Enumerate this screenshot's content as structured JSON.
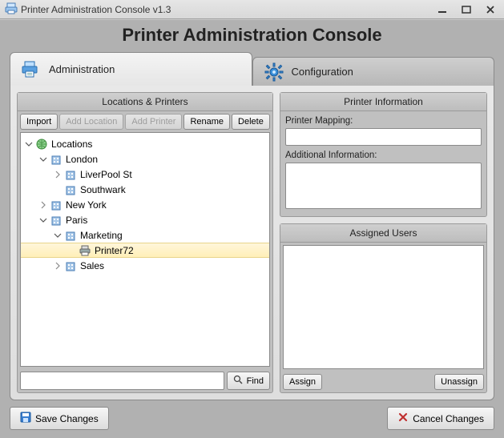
{
  "window": {
    "title": "Printer Administration Console v1.3",
    "page_heading": "Printer Administration Console"
  },
  "tabs": {
    "admin_label": "Administration",
    "config_label": "Configuration"
  },
  "left_panel": {
    "title": "Locations & Printers",
    "toolbar": {
      "import": "Import",
      "add_location": "Add Location",
      "add_printer": "Add Printer",
      "rename": "Rename",
      "delete": "Delete"
    },
    "find_label": "Find",
    "search_placeholder": "",
    "tree": {
      "root_label": "Locations",
      "london": "London",
      "liverpool": "LiverPool St",
      "southwark": "Southwark",
      "newyork": "New York",
      "paris": "Paris",
      "marketing": "Marketing",
      "printer72": "Printer72",
      "sales": "Sales"
    }
  },
  "info_panel": {
    "title": "Printer Information",
    "mapping_label": "Printer Mapping:",
    "mapping_value": "",
    "additional_label": "Additional Information:",
    "additional_value": ""
  },
  "users_panel": {
    "title": "Assigned Users",
    "assign_label": "Assign",
    "unassign_label": "Unassign"
  },
  "footer": {
    "save_label": "Save Changes",
    "cancel_label": "Cancel Changes"
  }
}
